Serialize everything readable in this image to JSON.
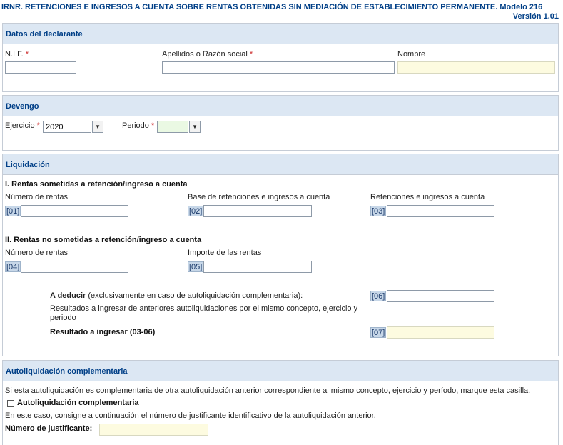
{
  "header": {
    "title": "IRNR. RETENCIONES E INGRESOS A CUENTA SOBRE RENTAS OBTENIDAS SIN MEDIACIÓN DE ESTABLECIMIENTO PERMANENTE. Modelo 216",
    "version": "Versión 1.01"
  },
  "declarante": {
    "title": "Datos del declarante",
    "nif_label": "N.I.F.",
    "apellidos_label": "Apellidos o Razón social",
    "nombre_label": "Nombre",
    "required_mark": "*",
    "nif_value": "",
    "apellidos_value": "",
    "nombre_value": ""
  },
  "devengo": {
    "title": "Devengo",
    "ejercicio_label": "Ejercicio",
    "ejercicio_value": "2020",
    "periodo_label": "Periodo",
    "periodo_value": "",
    "dropdown_glyph": "▼"
  },
  "liquidacion": {
    "title": "Liquidación",
    "sec1_title": "I. Rentas sometidas a retención/ingreso a cuenta",
    "num_rentas_label": "Número de rentas",
    "base_label": "Base de retenciones e ingresos a cuenta",
    "retenciones_label": "Retenciones e ingresos a cuenta",
    "box01": "[01]",
    "box02": "[02]",
    "box03": "[03]",
    "sec2_title": "II. Rentas no sometidas a retención/ingreso a cuenta",
    "num_rentas2_label": "Número de rentas",
    "importe_label": "Importe de las rentas",
    "box04": "[04]",
    "box05": "[05]",
    "deducir_bold": "A deducir",
    "deducir_rest": " (exclusivamente en caso de autoliquidación complementaria):",
    "deducir_desc": "Resultados a ingresar de anteriores autoliquidaciones por el mismo concepto, ejercicio y periodo",
    "box06": "[06]",
    "resultado_label": "Resultado a ingresar (03-06)",
    "box07": "[07]"
  },
  "complementaria": {
    "title": "Autoliquidación complementaria",
    "intro": "Si esta autoliquidación es complementaria de otra autoliquidación anterior correspondiente al mismo concepto, ejercicio y período, marque esta casilla.",
    "checkbox_label": "Autoliquidación complementaria",
    "consigne": "En este caso, consigne a continuación el número de justificante identificativo de la autoliquidación anterior.",
    "justificante_label": "Número de justificante:",
    "justificante_value": ""
  }
}
